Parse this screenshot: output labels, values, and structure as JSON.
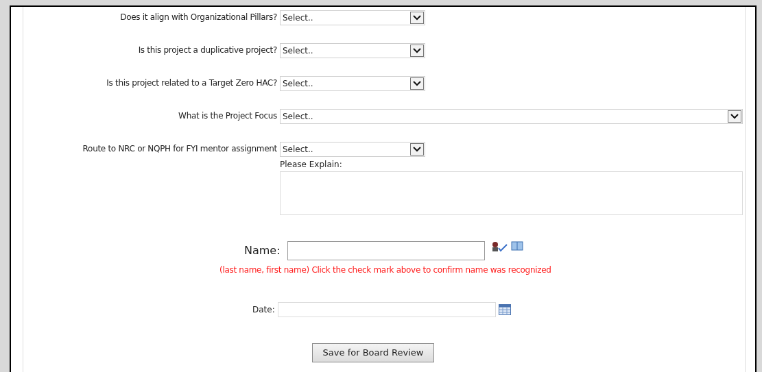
{
  "questions": [
    {
      "label": "Does it align with Organizational Pillars?",
      "kind": "select",
      "value": "Select.."
    },
    {
      "label": "Is this project a duplicative project?",
      "kind": "select",
      "value": "Select.."
    },
    {
      "label": "Is this project related to a Target Zero HAC?",
      "kind": "select",
      "value": "Select.."
    },
    {
      "label": "What is the Project Focus",
      "kind": "wide-select",
      "value": "Select.."
    },
    {
      "label": "Route to NRC or NQPH for FYI mentor assignment",
      "kind": "select",
      "value": "Select.."
    }
  ],
  "explain": {
    "label": "Please Explain:"
  },
  "name": {
    "label": "Name:",
    "hint": "(last name, first name) Click the check mark above to confirm name was recognized"
  },
  "date": {
    "label": "Date:"
  },
  "save_button": "Save for Board Review"
}
